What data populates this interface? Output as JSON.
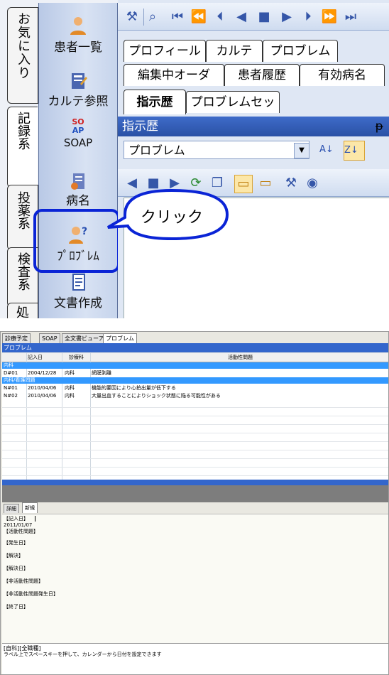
{
  "top": {
    "vertical_tabs": [
      {
        "label": "お気に入り"
      },
      {
        "label": "記録系",
        "active": true
      },
      {
        "label": "投薬系"
      },
      {
        "label": "検査系"
      },
      {
        "label": "処"
      }
    ],
    "rail_buttons": [
      {
        "label": "患者一覧",
        "icon": "person-icon"
      },
      {
        "label": "カルテ参照",
        "icon": "chart-record-icon"
      },
      {
        "label": "SOAP",
        "icon": "soap-icon",
        "badge_lines": [
          "SO",
          "AP"
        ]
      },
      {
        "label": "病名",
        "icon": "disease-icon"
      },
      {
        "label": "ﾌﾟﾛﾌﾞﾚﾑ",
        "icon": "problem-person-icon",
        "highlighted": true
      },
      {
        "label": "文書作成",
        "icon": "document-icon"
      }
    ],
    "tabs_row1": [
      "プロフィール",
      "カルテ",
      "プロブレム"
    ],
    "tabs_row2": [
      "編集中オーダ",
      "患者履歴",
      "有効病名"
    ],
    "tabs_row3": [
      "指示歴",
      "プロブレムセット"
    ],
    "section_header": "指示歴",
    "pin_glyph": "ᵽ",
    "dropdown_value": "プロブレム",
    "callout_text": "クリック",
    "accent_color": "#0a24d6"
  },
  "bottom": {
    "tabs": [
      "診療予定",
      "SOAP",
      "全文書ビューア",
      "プロブレム"
    ],
    "active_tab": "プロブレム",
    "title": "プロブレム",
    "columns": [
      "",
      "記入日",
      "診療科",
      "活動性問題"
    ],
    "groups": [
      {
        "label": "内科",
        "rows": [
          {
            "id": "D#01",
            "date": "2004/12/28",
            "dept": "内科",
            "problem": "網膜剥離"
          }
        ]
      },
      {
        "label": "内科/看護問題",
        "rows": [
          {
            "id": "N#01",
            "date": "2010/04/06",
            "dept": "内科",
            "problem": "機能的要因により心拍出量が低下する"
          },
          {
            "id": "N#02",
            "date": "2010/04/06",
            "dept": "内科",
            "problem": "大量出血することによりショック状態に陥る可能性がある"
          }
        ]
      }
    ],
    "detail_tabs": [
      "詳細",
      "新規"
    ],
    "detail_lines": [
      "【記入日】",
      "2011/01/07",
      "【活動性問題】",
      "【発生日】",
      "【解決】",
      "【解決日】",
      "【非活動性問題】",
      "【非活動性問題発生日】",
      "【終了日】"
    ],
    "footer_title": "[自科][全職種]",
    "footer_hint": "ラベル上でスペースキーを押して、カレンダーから日付を設定できます"
  }
}
